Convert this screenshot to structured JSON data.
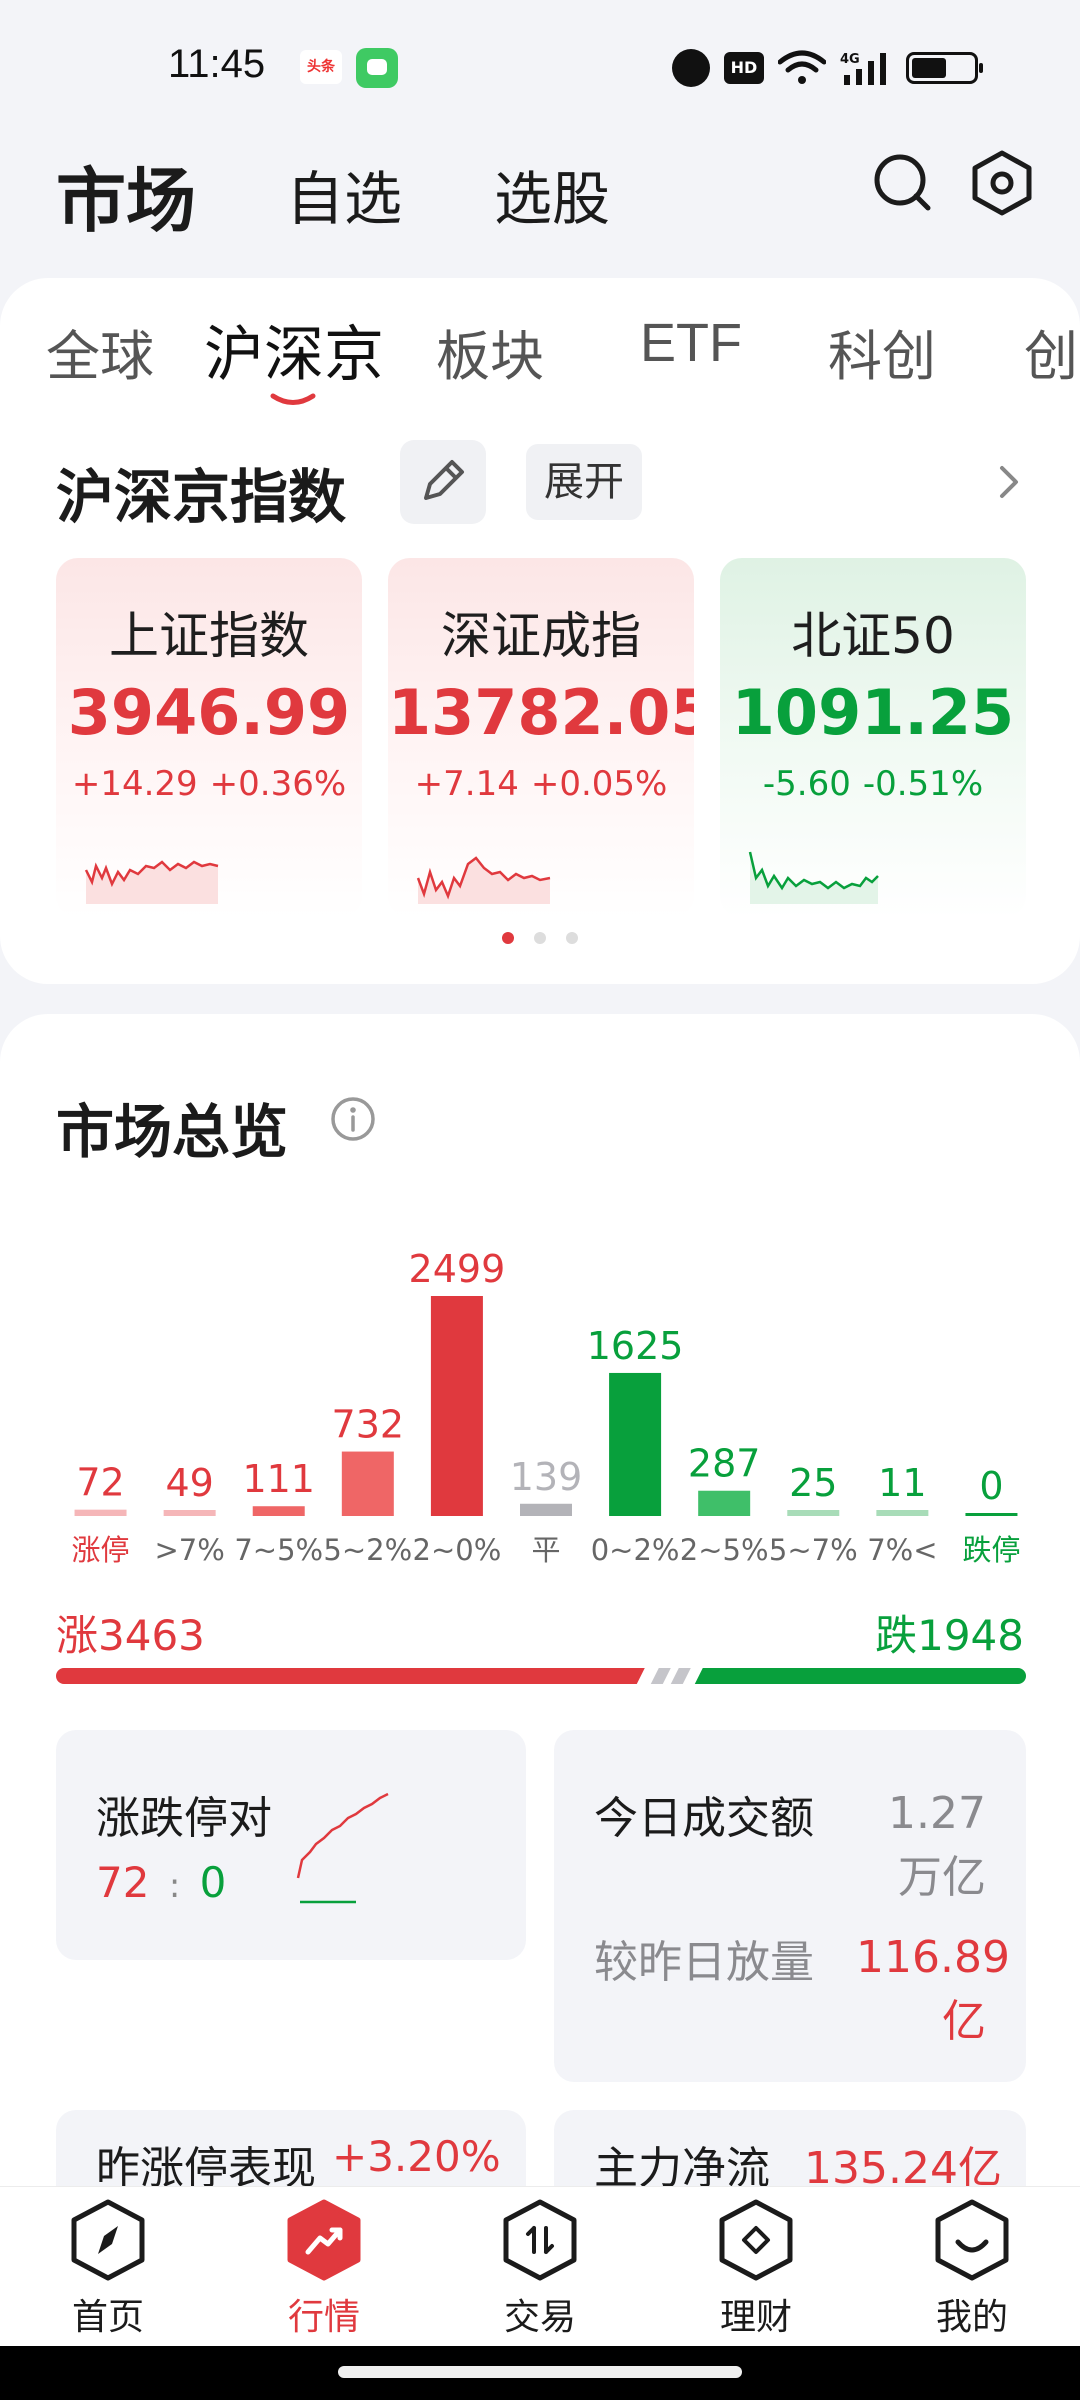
{
  "status_bar": {
    "time": "11:45",
    "app_badge": "头条",
    "network": "4G"
  },
  "header": {
    "title": "市场",
    "tabs": [
      "自选",
      "选股"
    ]
  },
  "market_tabs": [
    "全球",
    "沪深京",
    "板块",
    "ETF",
    "科创",
    "创"
  ],
  "market_tabs_active": "沪深京",
  "index_section": {
    "title": "沪深京指数",
    "expand_label": "展开",
    "cards": [
      {
        "name": "上证指数",
        "value": "3946.99",
        "change": "+14.29",
        "pct": "+0.36%",
        "trend": "up"
      },
      {
        "name": "深证成指",
        "value": "13782.05",
        "change": "+7.14",
        "pct": "+0.05%",
        "trend": "up"
      },
      {
        "name": "北证50",
        "value": "1091.25",
        "change": "-5.60",
        "pct": "-0.51%",
        "trend": "down"
      }
    ],
    "page_count": 3,
    "page_active": 0
  },
  "overview": {
    "title": "市场总览",
    "colors": {
      "up": "#e0393e",
      "up_light": "#ef6666",
      "up_pale": "#f5b6b8",
      "flat": "#b3b3b8",
      "down": "#08a03c",
      "down_light": "#3fbf69",
      "down_pale": "#a8dcb8"
    },
    "chart_data": {
      "type": "bar",
      "categories": [
        "涨停",
        ">7%",
        "7~5%",
        "5~2%",
        "2~0%",
        "平",
        "0~2%",
        "2~5%",
        "5~7%",
        "7%<",
        "跌停"
      ],
      "values": [
        72,
        49,
        111,
        732,
        2499,
        139,
        1625,
        287,
        25,
        11,
        0
      ],
      "value_labels": [
        "72",
        "49",
        "111",
        "732",
        "2499",
        "139",
        "1625",
        "287",
        "25",
        "11",
        "0"
      ],
      "tones": [
        "up_pale",
        "up_pale",
        "up_light",
        "up_light",
        "up",
        "flat",
        "down",
        "down_light",
        "down_pale",
        "down_pale",
        "down"
      ],
      "ylim": [
        0,
        2499
      ]
    },
    "up_label": "涨3463",
    "down_label": "跌1948",
    "up_count": 3463,
    "down_count": 1948,
    "limit_pair": {
      "title": "涨跌停对",
      "up": "72",
      "sep": ":",
      "down": "0"
    },
    "turnover": {
      "title": "今日成交额",
      "value": "1.27万亿",
      "compare_label": "较昨日放量",
      "compare_value": "116.89亿"
    },
    "yesterday_limit": {
      "title": "昨涨停表现",
      "value": "+3.20%"
    },
    "main_flow": {
      "title": "主力净流",
      "value": "135.24亿"
    }
  },
  "bottom_nav": [
    {
      "label": "首页",
      "icon": "compass-icon"
    },
    {
      "label": "行情",
      "icon": "trend-icon",
      "active": true
    },
    {
      "label": "交易",
      "icon": "trade-icon"
    },
    {
      "label": "理财",
      "icon": "wealth-icon"
    },
    {
      "label": "我的",
      "icon": "profile-icon"
    }
  ]
}
